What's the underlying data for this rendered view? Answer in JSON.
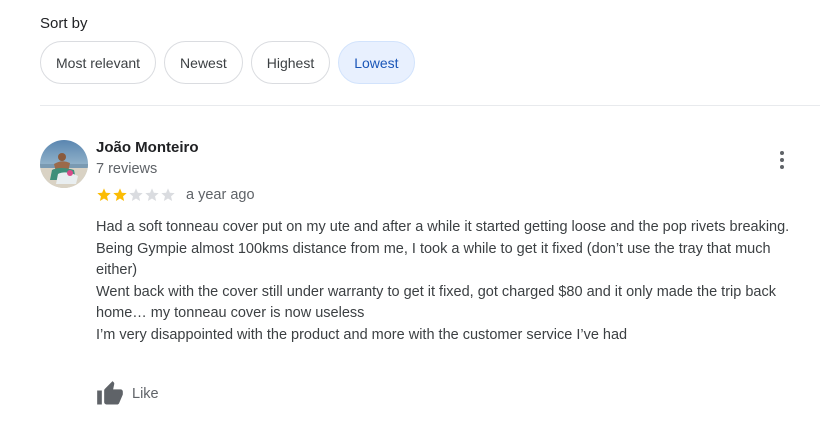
{
  "sort": {
    "label": "Sort by",
    "options": [
      {
        "label": "Most relevant",
        "selected": false
      },
      {
        "label": "Newest",
        "selected": false
      },
      {
        "label": "Highest",
        "selected": false
      },
      {
        "label": "Lowest",
        "selected": true
      }
    ]
  },
  "review": {
    "reviewer_name": "João Monteiro",
    "reviewer_reviews": "7 reviews",
    "rating": 2,
    "rating_max": 5,
    "date": "a year ago",
    "body_lines": [
      "Had a soft tonneau cover put on my ute and after a while it started getting loose and the pop rivets breaking.",
      "Being Gympie almost 100kms distance from me, I took a while to get it fixed (don’t use the tray that much either)",
      "Went back with the cover still under warranty to get it fixed, got charged $80 and it only made the trip back home… my tonneau cover is now useless",
      "I’m very disappointed with the product and more with the customer service I’ve had"
    ],
    "like_label": "Like"
  },
  "colors": {
    "star_filled": "#fbbc04",
    "star_empty": "#dadce0",
    "selected_chip_bg": "#e8f0fe",
    "selected_chip_text": "#1a56b8"
  },
  "icons": {
    "more": "more-vert-icon",
    "like": "thumb-up-icon"
  }
}
